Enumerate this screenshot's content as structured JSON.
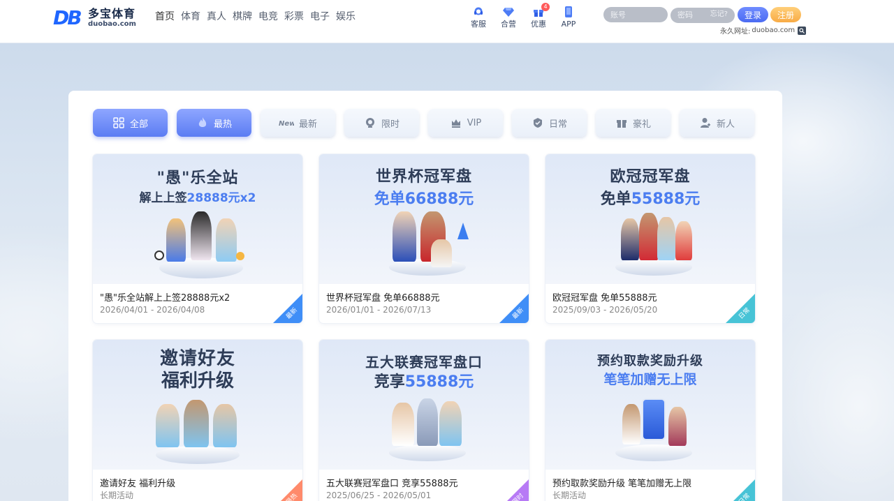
{
  "brand": {
    "logo_mark": "DB",
    "name_cn": "多宝体育",
    "domain": "duobao.com"
  },
  "nav": [
    "首页",
    "体育",
    "真人",
    "棋牌",
    "电竞",
    "彩票",
    "电子",
    "娱乐"
  ],
  "quick_links": [
    {
      "label": "客服",
      "icon": "headset-icon"
    },
    {
      "label": "合营",
      "icon": "diamond-icon"
    },
    {
      "label": "优惠",
      "icon": "gift-icon",
      "badge": "4"
    },
    {
      "label": "APP",
      "icon": "phone-icon"
    }
  ],
  "login": {
    "username_placeholder": "账号",
    "password_placeholder": "密码",
    "forgot": "忘记?",
    "login_btn": "登录",
    "register_btn": "注册",
    "permanent_label": "永久网址:",
    "permanent_url": "duobao.com"
  },
  "tabs": [
    {
      "label": "全部",
      "icon": "grid-icon",
      "active": true
    },
    {
      "label": "最热",
      "icon": "flame-icon",
      "active": true
    },
    {
      "label": "最新",
      "icon": "new-icon",
      "active": false
    },
    {
      "label": "限时",
      "icon": "clock-icon",
      "active": false
    },
    {
      "label": "VIP",
      "icon": "crown-icon",
      "active": false
    },
    {
      "label": "日常",
      "icon": "shield-check-icon",
      "active": false
    },
    {
      "label": "豪礼",
      "icon": "gift-icon",
      "active": false
    },
    {
      "label": "新人",
      "icon": "user-add-icon",
      "active": false
    }
  ],
  "promos": [
    {
      "title_line1": "\"愚\"乐全站",
      "title_line2_prefix": "解上上签",
      "title_line2_highlight": "28888元x2",
      "caption": "\"愚\"乐全站解上上签28888元x2",
      "date": "2026/04/01 - 2026/04/08",
      "tag": "最新",
      "tag_color": "#3f8ef7"
    },
    {
      "title_line1": "世界杯冠军盘",
      "title_line2_prefix": "免单",
      "title_line2_highlight": "66888元",
      "caption": "世界杯冠军盘 免单66888元",
      "date": "2026/01/01 - 2026/07/13",
      "tag": "最新",
      "tag_color": "#3f8ef7"
    },
    {
      "title_line1": "欧冠冠军盘",
      "title_line2_prefix": "免单",
      "title_line2_highlight": "55888元",
      "caption": "欧冠冠军盘 免单55888元",
      "date": "2025/09/03 - 2026/05/20",
      "tag": "日常",
      "tag_color": "#47c3d6"
    },
    {
      "title_line1": "邀请好友",
      "title_line2_prefix": "福利升级",
      "title_line2_highlight": "",
      "caption": "邀请好友 福利升级",
      "date": "长期活动",
      "tag": "最热",
      "tag_color": "#ff8a6b"
    },
    {
      "title_line1": "五大联赛冠军盘口",
      "title_line2_prefix": "竞享",
      "title_line2_highlight": "55888元",
      "caption": "五大联赛冠军盘口 竞享55888元",
      "date": "2025/06/25 - 2026/05/01",
      "tag": "限时",
      "tag_color": "#b77af5"
    },
    {
      "title_line1": "预约取款奖励升级",
      "title_line2_prefix": "笔笔加赠无上限",
      "title_line2_highlight": "",
      "caption": "预约取款奖励升级 笔笔加赠无上限",
      "date": "长期活动",
      "tag": "日常",
      "tag_color": "#47c3d6"
    }
  ]
}
